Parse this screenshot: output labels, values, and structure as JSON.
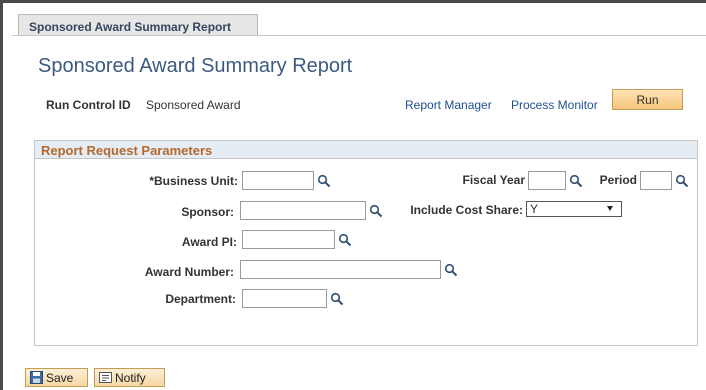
{
  "tab": {
    "label": "Sponsored Award Summary Report"
  },
  "page": {
    "title": "Sponsored Award Summary Report"
  },
  "run_control": {
    "label": "Run Control ID",
    "value": "Sponsored Award"
  },
  "links": {
    "report_manager": "Report Manager",
    "process_monitor": "Process Monitor"
  },
  "run_button": {
    "label": "Run"
  },
  "params": {
    "header": "Report Request Parameters",
    "business_unit_label": "*Business Unit:",
    "fiscal_year_label": "Fiscal Year",
    "period_label": "Period",
    "sponsor_label": "Sponsor:",
    "include_cost_share_label": "Include Cost Share:",
    "include_cost_share_value": "Y",
    "award_pi_label": "Award PI:",
    "award_number_label": "Award Number:",
    "department_label": "Department:",
    "values": {
      "business_unit": "",
      "fiscal_year": "",
      "period": "",
      "sponsor": "",
      "award_pi": "",
      "award_number": "",
      "department": ""
    }
  },
  "footer": {
    "save_label": "Save",
    "notify_label": "Notify"
  },
  "colors": {
    "title": "#3c5a80",
    "section_header_text": "#b26a2e",
    "link": "#1e4f8f",
    "button": "#f6c57b"
  },
  "icons": [
    "lookup-magnifier-icon",
    "save-floppy-icon",
    "notify-icon",
    "dropdown-caret-icon"
  ]
}
